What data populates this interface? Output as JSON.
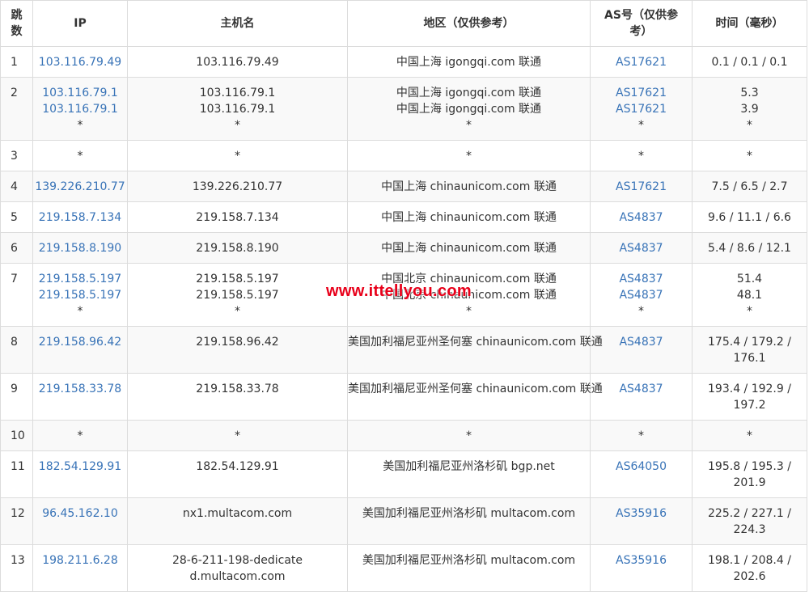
{
  "headers": {
    "hop": "跳数",
    "ip": "IP",
    "host": "主机名",
    "region": "地区（仅供参考）",
    "as": "AS号（仅供参考）",
    "time": "时间（毫秒）"
  },
  "watermark": "www.ittellyou.com",
  "rows": [
    {
      "hop": "1",
      "ip": [
        "103.116.79.49"
      ],
      "host": [
        "103.116.79.49"
      ],
      "region": [
        "中国上海 igongqi.com 联通"
      ],
      "as": [
        "AS17621"
      ],
      "time": [
        "0.1 / 0.1 / 0.1"
      ]
    },
    {
      "hop": "2",
      "ip": [
        "103.116.79.1",
        "103.116.79.1",
        "*"
      ],
      "host": [
        "103.116.79.1",
        "103.116.79.1",
        "*"
      ],
      "region": [
        "中国上海 igongqi.com 联通",
        "中国上海 igongqi.com 联通",
        "*"
      ],
      "as": [
        "AS17621",
        "AS17621",
        "*"
      ],
      "time": [
        "5.3",
        "3.9",
        "*"
      ]
    },
    {
      "hop": "3",
      "ip": [
        "*"
      ],
      "host": [
        "*"
      ],
      "region": [
        "*"
      ],
      "as": [
        "*"
      ],
      "time": [
        "*"
      ]
    },
    {
      "hop": "4",
      "ip": [
        "139.226.210.77"
      ],
      "host": [
        "139.226.210.77"
      ],
      "region": [
        "中国上海 chinaunicom.com 联通"
      ],
      "as": [
        "AS17621"
      ],
      "time": [
        "7.5 / 6.5 / 2.7"
      ]
    },
    {
      "hop": "5",
      "ip": [
        "219.158.7.134"
      ],
      "host": [
        "219.158.7.134"
      ],
      "region": [
        "中国上海 chinaunicom.com 联通"
      ],
      "as": [
        "AS4837"
      ],
      "time": [
        "9.6 / 11.1 / 6.6"
      ]
    },
    {
      "hop": "6",
      "ip": [
        "219.158.8.190"
      ],
      "host": [
        "219.158.8.190"
      ],
      "region": [
        "中国上海 chinaunicom.com 联通"
      ],
      "as": [
        "AS4837"
      ],
      "time": [
        "5.4 / 8.6 / 12.1"
      ]
    },
    {
      "hop": "7",
      "ip": [
        "219.158.5.197",
        "219.158.5.197",
        "*"
      ],
      "host": [
        "219.158.5.197",
        "219.158.5.197",
        "*"
      ],
      "region": [
        "中国北京 chinaunicom.com 联通",
        "中国北京 chinaunicom.com 联通",
        "*"
      ],
      "as": [
        "AS4837",
        "AS4837",
        "*"
      ],
      "time": [
        "51.4",
        "48.1",
        "*"
      ]
    },
    {
      "hop": "8",
      "ip": [
        "219.158.96.42"
      ],
      "host": [
        "219.158.96.42"
      ],
      "region": [
        "美国加利福尼亚州圣何塞 chinaunicom.com 联通"
      ],
      "as": [
        "AS4837"
      ],
      "time": [
        "175.4 / 179.2 / 176.1"
      ]
    },
    {
      "hop": "9",
      "ip": [
        "219.158.33.78"
      ],
      "host": [
        "219.158.33.78"
      ],
      "region": [
        "美国加利福尼亚州圣何塞 chinaunicom.com 联通"
      ],
      "as": [
        "AS4837"
      ],
      "time": [
        "193.4 / 192.9 / 197.2"
      ]
    },
    {
      "hop": "10",
      "ip": [
        "*"
      ],
      "host": [
        "*"
      ],
      "region": [
        "*"
      ],
      "as": [
        "*"
      ],
      "time": [
        "*"
      ]
    },
    {
      "hop": "11",
      "ip": [
        "182.54.129.91"
      ],
      "host": [
        "182.54.129.91"
      ],
      "region": [
        "美国加利福尼亚州洛杉矶 bgp.net"
      ],
      "as": [
        "AS64050"
      ],
      "time": [
        "195.8 / 195.3 / 201.9"
      ]
    },
    {
      "hop": "12",
      "ip": [
        "96.45.162.10"
      ],
      "host": [
        "nx1.multacom.com"
      ],
      "region": [
        "美国加利福尼亚州洛杉矶 multacom.com"
      ],
      "as": [
        "AS35916"
      ],
      "time": [
        "225.2 / 227.1 / 224.3"
      ]
    },
    {
      "hop": "13",
      "ip": [
        "198.211.6.28"
      ],
      "host": [
        "28-6-211-198-dedicated.multacom.com"
      ],
      "region": [
        "美国加利福尼亚州洛杉矶 multacom.com"
      ],
      "as": [
        "AS35916"
      ],
      "time": [
        "198.1 / 208.4 / 202.6"
      ]
    }
  ]
}
